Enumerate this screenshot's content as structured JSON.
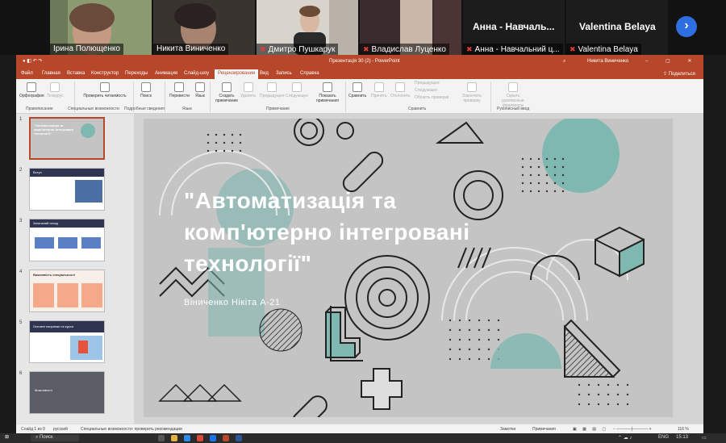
{
  "participants": [
    {
      "name": "Ірина Полющенко",
      "muted": false
    },
    {
      "name": "Никита Виниченко",
      "muted": false
    },
    {
      "name": "Дмитро Пушкарук",
      "muted": true
    },
    {
      "name": "Владислав Луценко",
      "muted": true
    },
    {
      "name": "Анна - Навчальний ц...",
      "display": "Анна  -  Навчаль...",
      "muted": true
    },
    {
      "name": "Valentina Belaya",
      "display": "Valentina Belaya",
      "muted": true
    }
  ],
  "next_icon": "chevron-right-icon",
  "window": {
    "title": "Презентація 30 (2) - PowerPoint",
    "user": "Никита Виниченко"
  },
  "menu": {
    "tabs": [
      "Файл",
      "Главная",
      "Вставка",
      "Конструктор",
      "Переходы",
      "Анимация",
      "Слайд-шоу",
      "Рецензирование",
      "Вид",
      "Запись",
      "Справка"
    ],
    "active": "Рецензирование",
    "share": "Поделиться"
  },
  "ribbon": {
    "spelling": "Орфография",
    "thesaurus": "Тезаурус",
    "check_accessibility": "Проверить читаемость",
    "search": "Поиск",
    "translate": "Перевести",
    "language": "Язык",
    "new_comment": "Создать примечание",
    "delete": "Удалить",
    "previous": "Предыдущее",
    "next": "Следующее",
    "show_comments": "Показать примечания",
    "compare": "Сравнить",
    "accept": "Принять",
    "reject": "Отклонить",
    "prev_change": "Предыдущее",
    "next_change": "Следующее",
    "reviewing_pane": "Область проверки",
    "end_review": "Закончить проверку",
    "hide_ink": "Скрыть рукописные фрагменты",
    "groups": {
      "proofing": "Правописание",
      "accessibility": "Специальные возможности",
      "insights": "Подробные сведения",
      "language": "Язык",
      "comments": "Примечание",
      "compare": "Сравнить",
      "ink": "Рукописный ввод"
    }
  },
  "slides_panel": {
    "slides": [
      {
        "num": "1",
        "title": "\"Автоматизація та комп'ютерно інтегровані технології\""
      },
      {
        "num": "2",
        "title": "Вступ"
      },
      {
        "num": "3",
        "title": "Загальний огляд"
      },
      {
        "num": "4",
        "title": "Важливість спеціальності"
      },
      {
        "num": "5",
        "title": "Основні напрямки та курси"
      },
      {
        "num": "6",
        "title": "Можливості"
      }
    ]
  },
  "slide": {
    "title": "\"Автоматизація та комп'ютерно інтегровані технології\"",
    "subtitle": "Віниченко Нікіта А-21"
  },
  "status": {
    "slide_count": "Слайд 1 из 9",
    "language": "русский",
    "accessibility": "Специальные возможности: проверить рекомендации",
    "notes": "Заметки",
    "comments": "Примечания",
    "zoom": "116 %"
  },
  "taskbar": {
    "search": "Поиск",
    "lang": "ENG",
    "time": "15:13"
  },
  "colors": {
    "ppt_accent": "#b7472a",
    "teal": "#7fb8b0",
    "slide_bg": "#c4c4c4"
  }
}
